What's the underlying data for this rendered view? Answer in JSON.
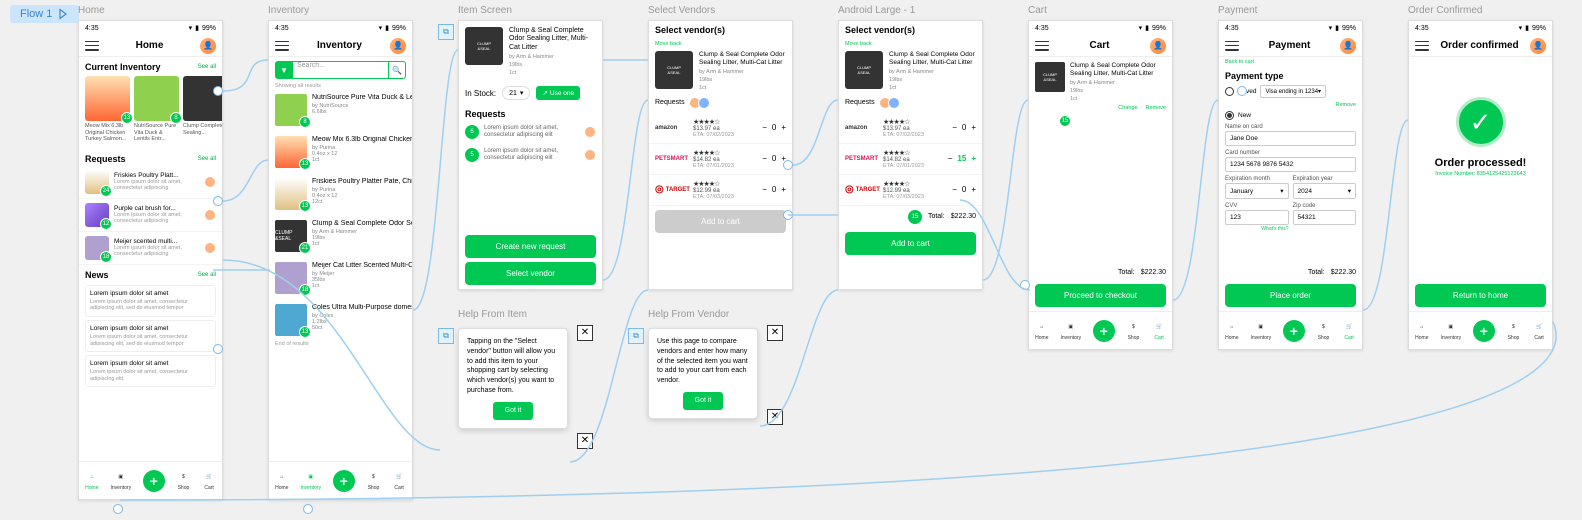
{
  "flow": {
    "label": "Flow 1"
  },
  "labels": {
    "home": "Home",
    "inventory": "Inventory",
    "item": "Item Screen",
    "vendors": "Select Vendors",
    "android": "Android Large - 1",
    "cart": "Cart",
    "payment": "Payment",
    "confirmed": "Order Confirmed",
    "help_item": "Help From Item",
    "help_vendor": "Help From Vendor"
  },
  "status": {
    "time": "4:35",
    "battery": "99%"
  },
  "header": {
    "home": "Home",
    "inventory": "Inventory",
    "cart": "Cart",
    "payment": "Payment",
    "confirmed": "Order confirmed"
  },
  "see_all": "See all",
  "home_screen": {
    "inventory_title": "Current Inventory",
    "inv_items": [
      {
        "name": "Meow Mix 6.3lb Original Chicken Turkey Salmon...",
        "qty": "13"
      },
      {
        "name": "NutriSource Pure Vita Duck & Lentils Entr...",
        "qty": "8"
      },
      {
        "name": "Clump Complete Sealing...",
        "qty": ""
      }
    ],
    "requests_title": "Requests",
    "requests": [
      {
        "name": "Friskies Poultry Platt...",
        "desc": "Lorem ipsum dolor sit amet, consectetur adipiscing",
        "qty": "24"
      },
      {
        "name": "Purple cat brush for...",
        "desc": "Lorem ipsum dolor sit amet, consectetur adipiscing",
        "qty": "12"
      },
      {
        "name": "Meijer scented multi...",
        "desc": "Lorem ipsum dolor sit amet, consectetur adipiscing",
        "qty": "18"
      }
    ],
    "news_title": "News",
    "news": [
      {
        "title": "Lorem ipsum dolor sit amet",
        "body": "Lorem ipsum dolor sit amet, consectetur adipiscing elit, sed do eiusmod tempor"
      },
      {
        "title": "Lorem ipsum dolor sit amet",
        "body": "Lorem ipsum dolor sit amet, consectetur adipiscing elit, sed do eiusmod tempor"
      },
      {
        "title": "Lorem ipsum dolor sit amet",
        "body": "Lorem ipsum dolor sit amet, consectetur adipiscing elit."
      }
    ]
  },
  "tabs": {
    "home": "Home",
    "inventory": "Inventory",
    "shop": "Shop",
    "cart": "Cart"
  },
  "inventory_screen": {
    "search_placeholder": "Search...",
    "showing": "Showing all results",
    "items": [
      {
        "name": "NutriSource Pure Vita Duck & Lentils Entree Cat Food",
        "by": "by NutriSource",
        "wt": "6.6lbs",
        "ct": "",
        "qty": "8"
      },
      {
        "name": "Meow Mix 6.3lb Original Chicken Turkey Salmon...",
        "by": "by Purina",
        "wt": "0.4oz x 12",
        "ct": "1ct",
        "qty": "13"
      },
      {
        "name": "Friskies Poultry Platter Pate, Chicken Flavor, 12ct",
        "by": "by Purina",
        "wt": "0.4oz x 12",
        "ct": "12ct",
        "qty": "13"
      },
      {
        "name": "Clump & Seal Complete Odor Sealing Litter, Multi...",
        "by": "by Arm & Hammer",
        "wt": "19lbs",
        "ct": "1ct",
        "qty": "21"
      },
      {
        "name": "Meijer Cat Litter Scented Multi-Cat Scoop Litter...",
        "by": "by Meijer",
        "wt": "35lbs",
        "ct": "1ct",
        "qty": "18"
      },
      {
        "name": "Coles Ultra Multi-Purpose domestic cleaning wipes, ...",
        "by": "by Coles",
        "wt": "1.2lbs",
        "ct": "50ct",
        "qty": "13"
      }
    ],
    "end": "End of results"
  },
  "product": {
    "name": "Clump & Seal Complete Odor Sealing Litter, Multi-Cat Litter",
    "by": "by Arm & Hammer",
    "wt": "19lbs",
    "ct": "1ct"
  },
  "item_screen": {
    "stock_label": "In Stock:",
    "stock_qty": "21",
    "use_one": "Use one",
    "requests_title": "Requests",
    "reqs": [
      {
        "qty": "6",
        "text": "Lorem ipsum dolor sit amet, consectetur adipiscing elit"
      },
      {
        "qty": "5",
        "text": "Lorem ipsum dolor sit amet, consectetur adipiscing elit"
      }
    ],
    "create_btn": "Create new request",
    "select_btn": "Select vendor"
  },
  "vendors_screen": {
    "title": "Select vendor(s)",
    "back": "Move back",
    "requests_label": "Requests",
    "vendors": [
      {
        "logo": "amazon",
        "stars": "★★★★☆",
        "price": "$13.97 ea",
        "eta": "ETA: 07/02/2023",
        "qty": "0"
      },
      {
        "logo": "PETSMART",
        "stars": "★★★★☆",
        "price": "$14.82 ea",
        "eta": "ETA: 07/01/2023",
        "qty": "0"
      },
      {
        "logo": "TARGET",
        "stars": "★★★★☆",
        "price": "$12.99 ea",
        "eta": "ETA: 07/03/2023",
        "qty": "0"
      }
    ],
    "add_btn": "Add to cart"
  },
  "android_screen": {
    "title": "Select vendor(s)",
    "vendors": [
      {
        "logo": "amazon",
        "stars": "★★★★☆",
        "price": "$13.97 ea",
        "eta": "ETA: 07/02/2023",
        "qty": "0"
      },
      {
        "logo": "PETSMART",
        "stars": "★★★★☆",
        "price": "$14.82 ea",
        "eta": "ETA: 07/01/2023",
        "qty": "15",
        "plus": true
      },
      {
        "logo": "TARGET",
        "stars": "★★★★☆",
        "price": "$12.99 ea",
        "eta": "ETA: 07/03/2023",
        "qty": "0"
      }
    ],
    "total_count": "15",
    "total_label": "Total:",
    "total_price": "$222.30",
    "add_btn": "Add to cart"
  },
  "cart_screen": {
    "item_qty": "15",
    "change": "Change",
    "remove": "Remove",
    "total_label": "Total:",
    "total_price": "$222.30",
    "proceed_btn": "Proceed to checkout"
  },
  "payment_screen": {
    "back": "Back to cart",
    "title": "Payment type",
    "saved": "Saved",
    "saved_card": "Visa ending in 1234",
    "remove": "Remove",
    "new": "New",
    "name_label": "Name on card",
    "name_val": "Jane Doe",
    "card_label": "Card number",
    "card_val": "1234 5678 9876 5432",
    "exp_m_label": "Expiration month",
    "exp_m_val": "January",
    "exp_y_label": "Expiration year",
    "exp_y_val": "2024",
    "cvv_label": "CVV",
    "cvv_val": "123",
    "zip_label": "Zip code",
    "zip_val": "54321",
    "whats_this": "What's this?",
    "total_label": "Total:",
    "total_price": "$222.30",
    "place_btn": "Place order"
  },
  "confirmed_screen": {
    "processed": "Order processed!",
    "invoice": "Invoice Number: 8354125425123643",
    "return_btn": "Return to home"
  },
  "help_item": {
    "text": "Tapping on the \"Select vendor\" button will allow you to add this item to your shopping cart by selecting which vendor(s) you want to purchase from.",
    "btn": "Got it"
  },
  "help_vendor": {
    "text": "Use this page to compare vendors and enter how many of the selected item you want to add to your cart from each vendor.",
    "btn": "Got it"
  }
}
